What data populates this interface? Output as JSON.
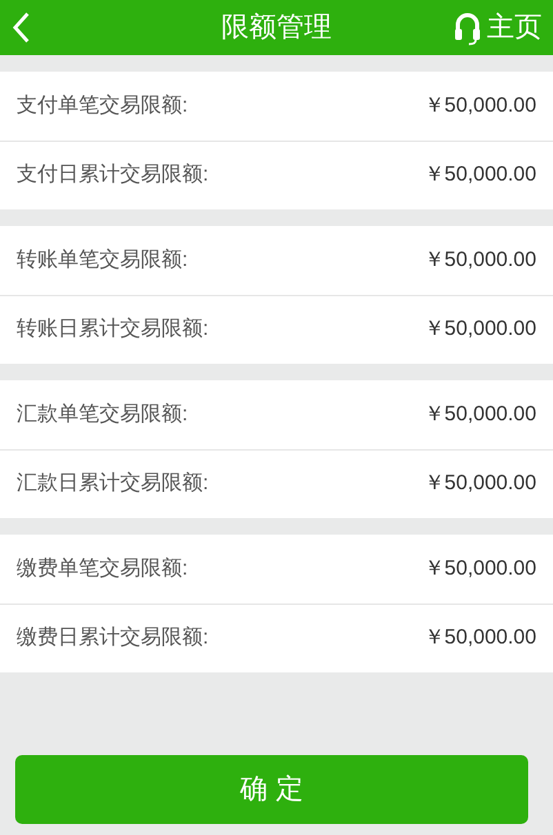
{
  "header": {
    "title": "限额管理",
    "home_label": "主页"
  },
  "groups": [
    {
      "rows": [
        {
          "label": "支付单笔交易限额:",
          "value": "￥50,000.00"
        },
        {
          "label": "支付日累计交易限额:",
          "value": "￥50,000.00"
        }
      ]
    },
    {
      "rows": [
        {
          "label": "转账单笔交易限额:",
          "value": "￥50,000.00"
        },
        {
          "label": "转账日累计交易限额:",
          "value": "￥50,000.00"
        }
      ]
    },
    {
      "rows": [
        {
          "label": "汇款单笔交易限额:",
          "value": "￥50,000.00"
        },
        {
          "label": "汇款日累计交易限额:",
          "value": "￥50,000.00"
        }
      ]
    },
    {
      "rows": [
        {
          "label": "缴费单笔交易限额:",
          "value": "￥50,000.00"
        },
        {
          "label": "缴费日累计交易限额:",
          "value": "￥50,000.00"
        }
      ]
    }
  ],
  "confirm_button": "确 定"
}
